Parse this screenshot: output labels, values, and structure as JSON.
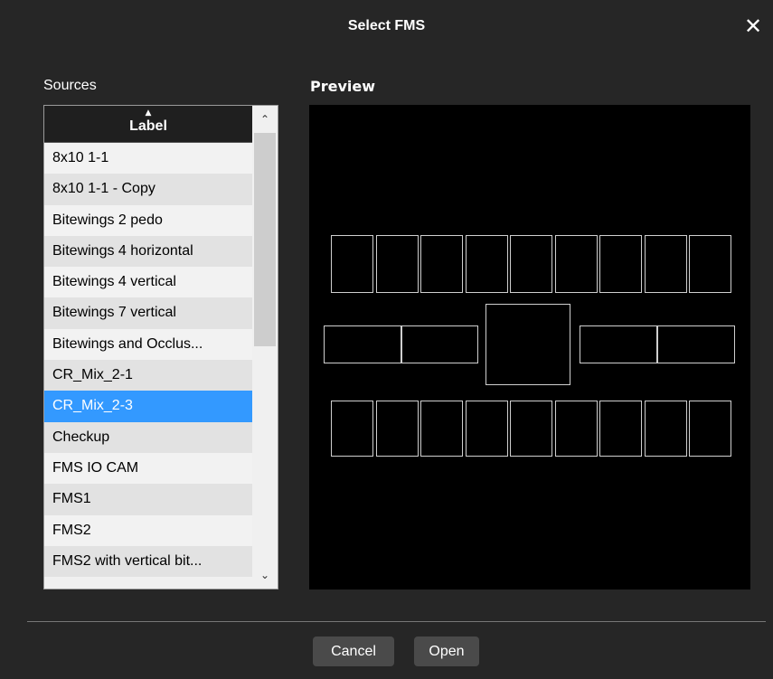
{
  "dialog": {
    "title": "Select FMS",
    "close_glyph": "✕"
  },
  "sources": {
    "label": "Sources",
    "column_header": "Label",
    "sort_glyph": "▲",
    "items": [
      "8x10 1-1",
      "8x10 1-1 - Copy",
      "Bitewings 2 pedo",
      "Bitewings 4 horizontal",
      "Bitewings 4 vertical",
      "Bitewings 7 vertical",
      "Bitewings and Occlus...",
      "CR_Mix_2-1",
      "CR_Mix_2-3",
      "Checkup",
      "FMS IO CAM",
      "FMS1",
      "FMS2",
      "FMS2 with vertical bit..."
    ],
    "selected_index": 8,
    "scroll_up_glyph": "⌃",
    "scroll_down_glyph": "⌄"
  },
  "preview": {
    "label": "Preview"
  },
  "buttons": {
    "cancel": "Cancel",
    "open": "Open"
  },
  "colors": {
    "selection": "#3399ff",
    "background": "#262626",
    "preview_bg": "#000000",
    "tile_border": "#cfcfcf"
  }
}
